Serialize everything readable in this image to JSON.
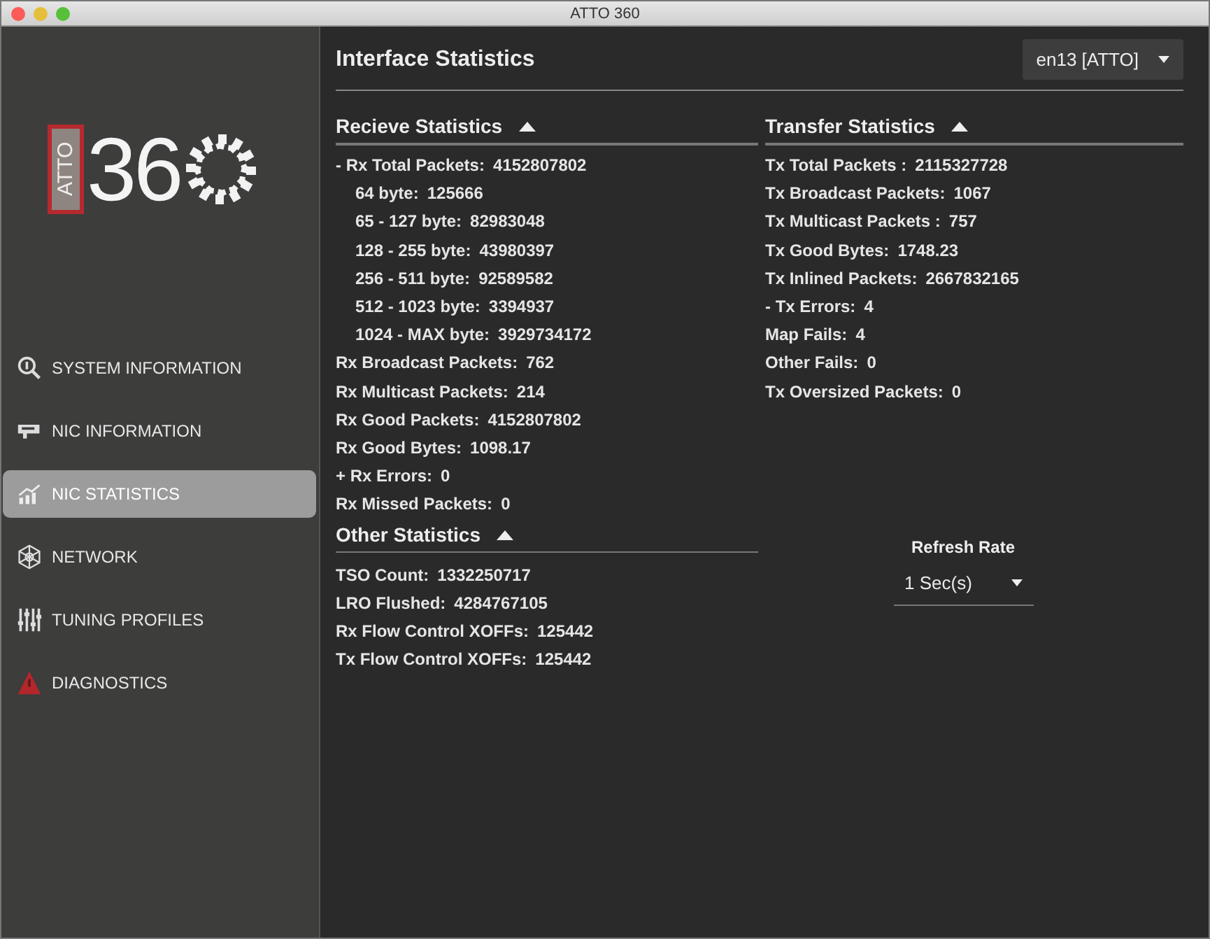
{
  "window": {
    "title": "ATTO 360"
  },
  "logo": {
    "badge": "ATTO",
    "number": "36"
  },
  "sidebar": {
    "items": [
      {
        "label": "SYSTEM INFORMATION",
        "selected": false
      },
      {
        "label": "NIC INFORMATION",
        "selected": false
      },
      {
        "label": "NIC STATISTICS",
        "selected": true
      },
      {
        "label": "NETWORK",
        "selected": false
      },
      {
        "label": "TUNING PROFILES",
        "selected": false
      },
      {
        "label": "DIAGNOSTICS",
        "selected": false
      }
    ]
  },
  "header": {
    "title": "Interface Statistics",
    "interface_select": {
      "value": "en13 [ATTO]"
    }
  },
  "receive": {
    "title": "Recieve Statistics",
    "expanded": true,
    "rows": [
      {
        "label": "- Rx Total Packets:",
        "value": "4152807802",
        "children": [
          {
            "label": "64 byte:",
            "value": "125666"
          },
          {
            "label": "65 - 127 byte:",
            "value": "82983048"
          },
          {
            "label": "128 - 255 byte:",
            "value": "43980397"
          },
          {
            "label": "256 - 511 byte:",
            "value": "92589582"
          },
          {
            "label": "512 - 1023 byte:",
            "value": "3394937"
          },
          {
            "label": "1024 - MAX byte:",
            "value": "3929734172"
          }
        ]
      },
      {
        "label": "Rx Broadcast Packets:",
        "value": "762"
      },
      {
        "label": "Rx Multicast Packets:",
        "value": "214"
      },
      {
        "label": "Rx Good Packets:",
        "value": "4152807802"
      },
      {
        "label": "Rx Good Bytes:",
        "value": "1098.17"
      },
      {
        "label": "+ Rx Errors:",
        "value": "0"
      },
      {
        "label": "Rx Missed Packets:",
        "value": "0"
      }
    ]
  },
  "other": {
    "title": "Other Statistics",
    "expanded": true,
    "rows": [
      {
        "label": "TSO Count:",
        "value": "1332250717"
      },
      {
        "label": "LRO Flushed:",
        "value": "4284767105"
      },
      {
        "label": "Rx Flow Control XOFFs:",
        "value": "125442"
      },
      {
        "label": "Tx Flow Control XOFFs:",
        "value": "125442"
      }
    ]
  },
  "transfer": {
    "title": "Transfer Statistics",
    "expanded": true,
    "rows": [
      {
        "label": "Tx Total Packets :",
        "value": "2115327728"
      },
      {
        "label": "Tx Broadcast Packets:",
        "value": "1067"
      },
      {
        "label": "Tx Multicast Packets :",
        "value": "757"
      },
      {
        "label": "Tx Good Bytes:",
        "value": "1748.23"
      },
      {
        "label": "Tx Inlined Packets:",
        "value": "2667832165"
      },
      {
        "label": "- Tx Errors:",
        "value": "4"
      },
      {
        "label": "Map Fails:",
        "value": "4"
      },
      {
        "label": "Other Fails:",
        "value": "0"
      },
      {
        "label": "Tx Oversized Packets:",
        "value": "0"
      }
    ]
  },
  "refresh": {
    "label": "Refresh Rate",
    "value": "1 Sec(s)"
  }
}
